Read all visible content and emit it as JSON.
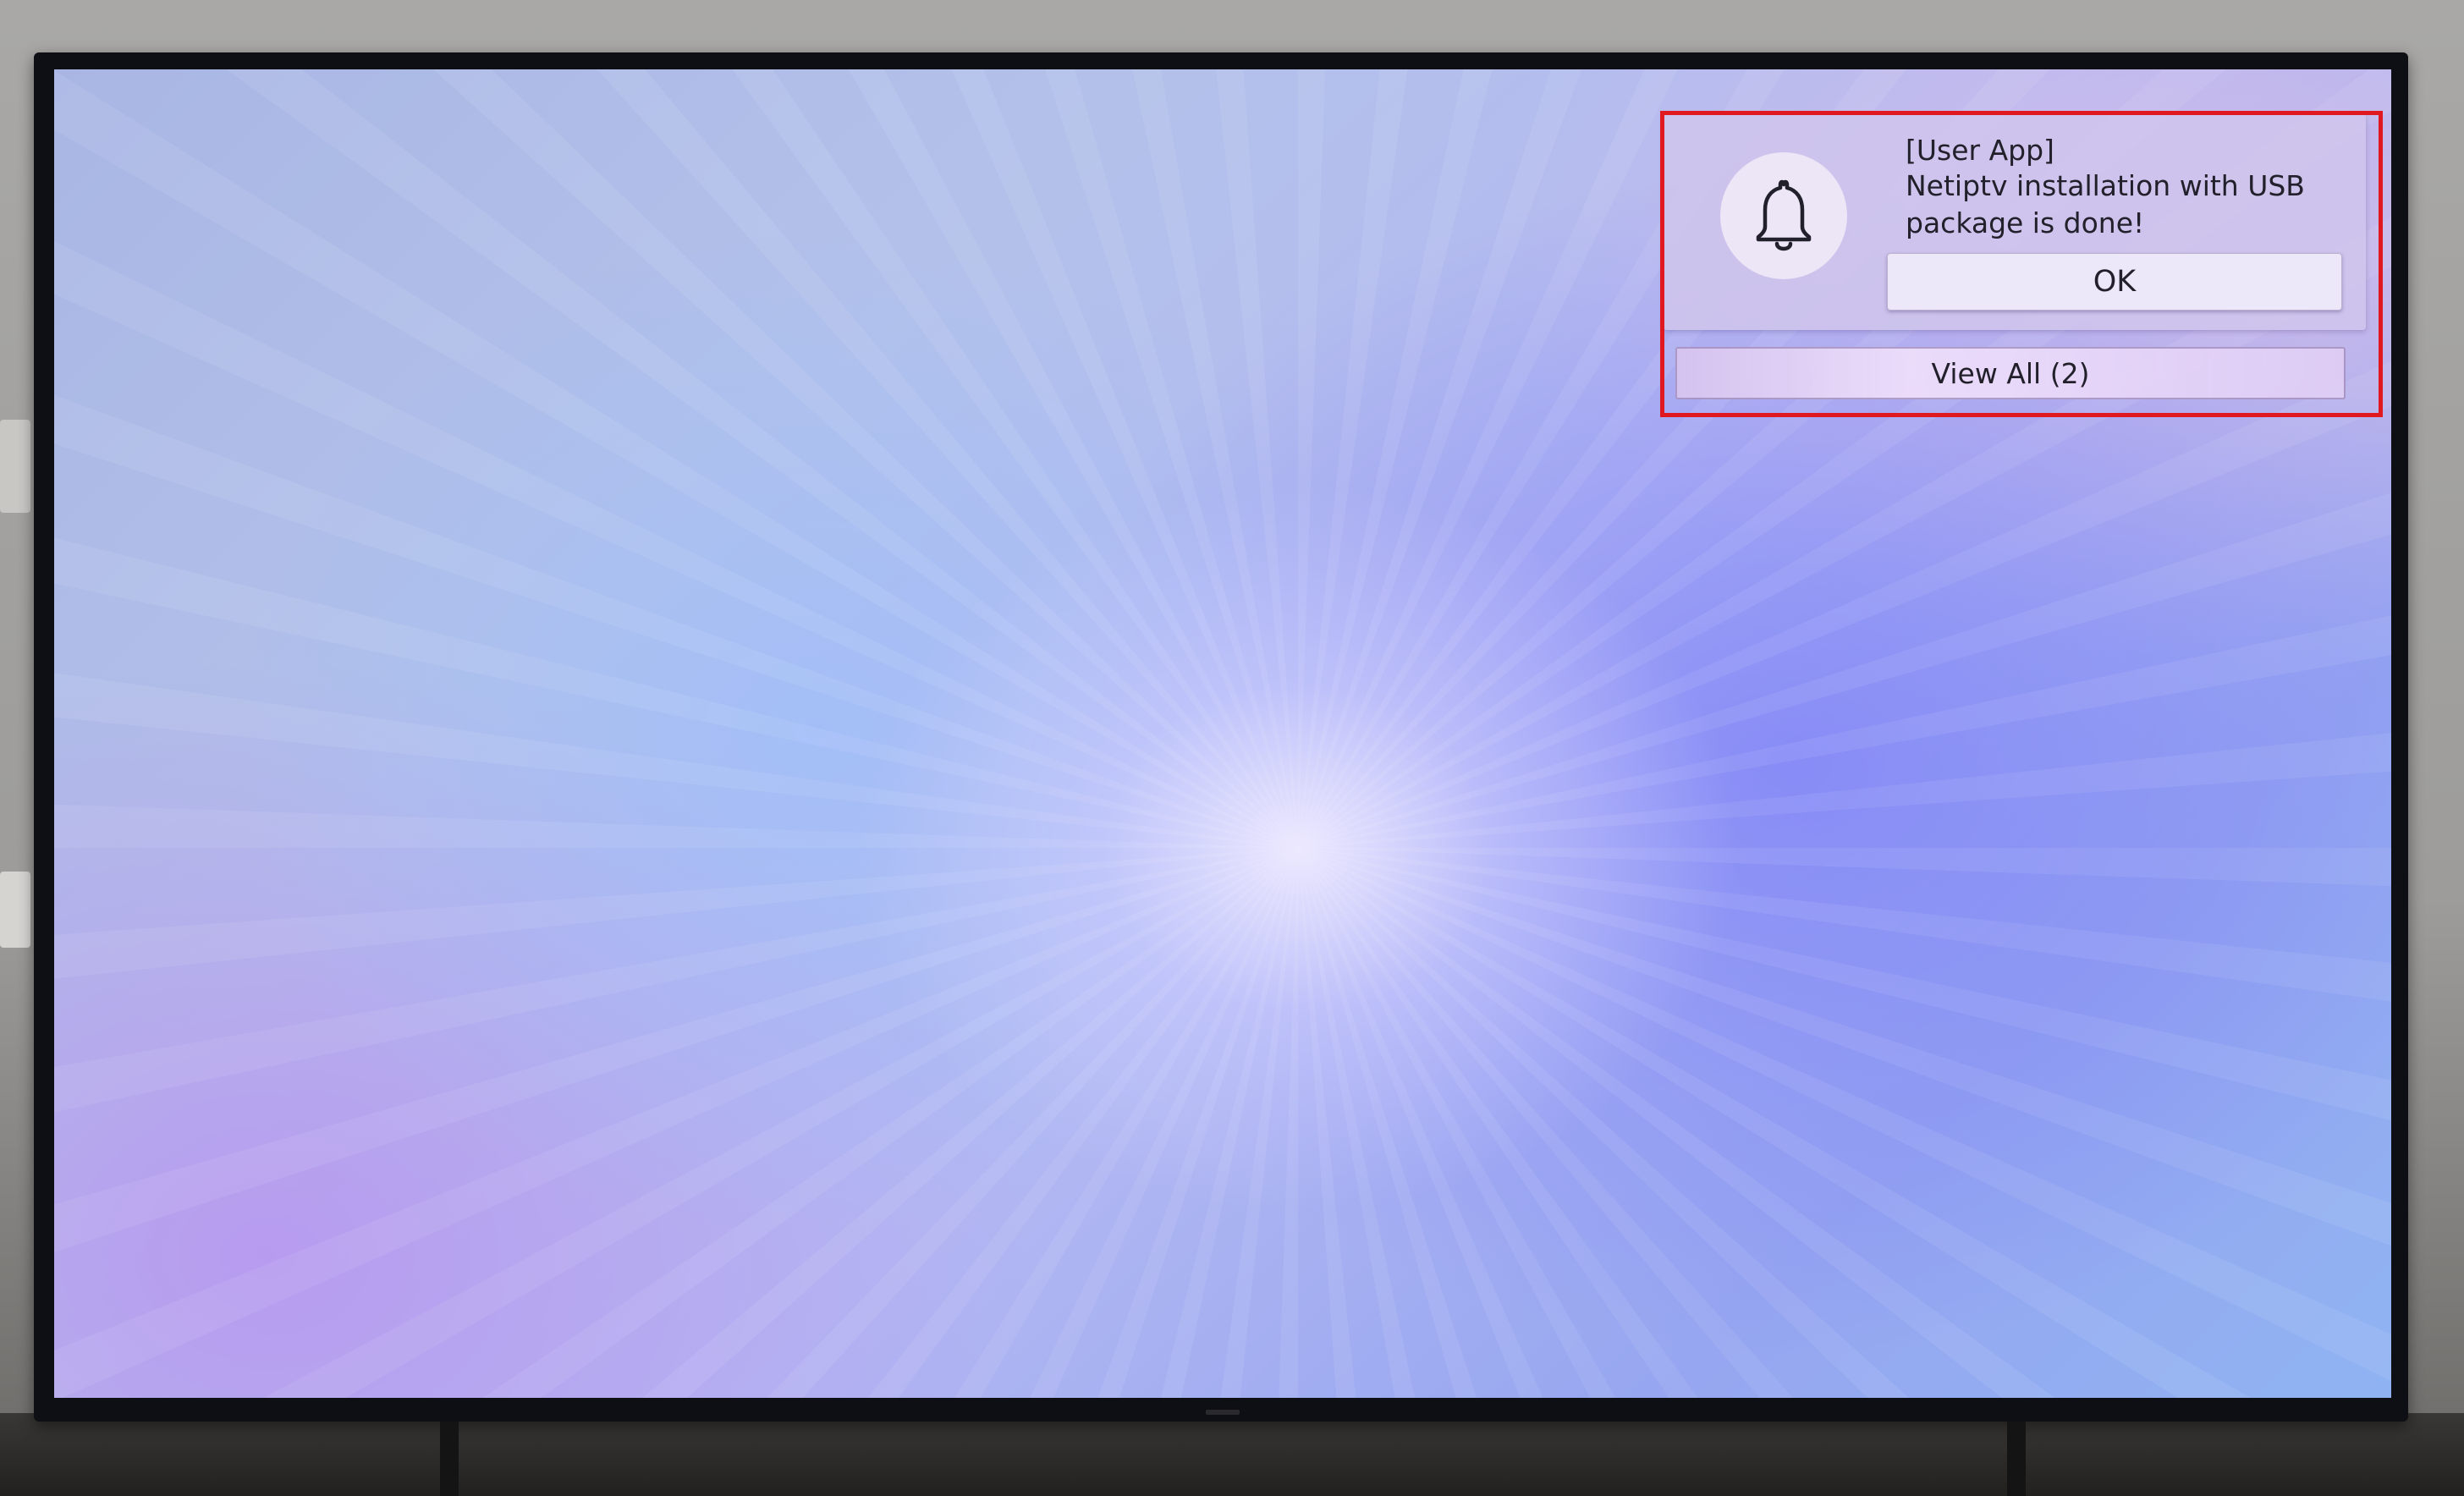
{
  "notification": {
    "icon": "bell-icon",
    "source": "[User App]",
    "message": "Netiptv installation with USB package is done!",
    "ok_label": "OK",
    "view_all_label": "View All (2)"
  },
  "colors": {
    "highlight_border": "#e0181f",
    "text": "#22202b"
  }
}
